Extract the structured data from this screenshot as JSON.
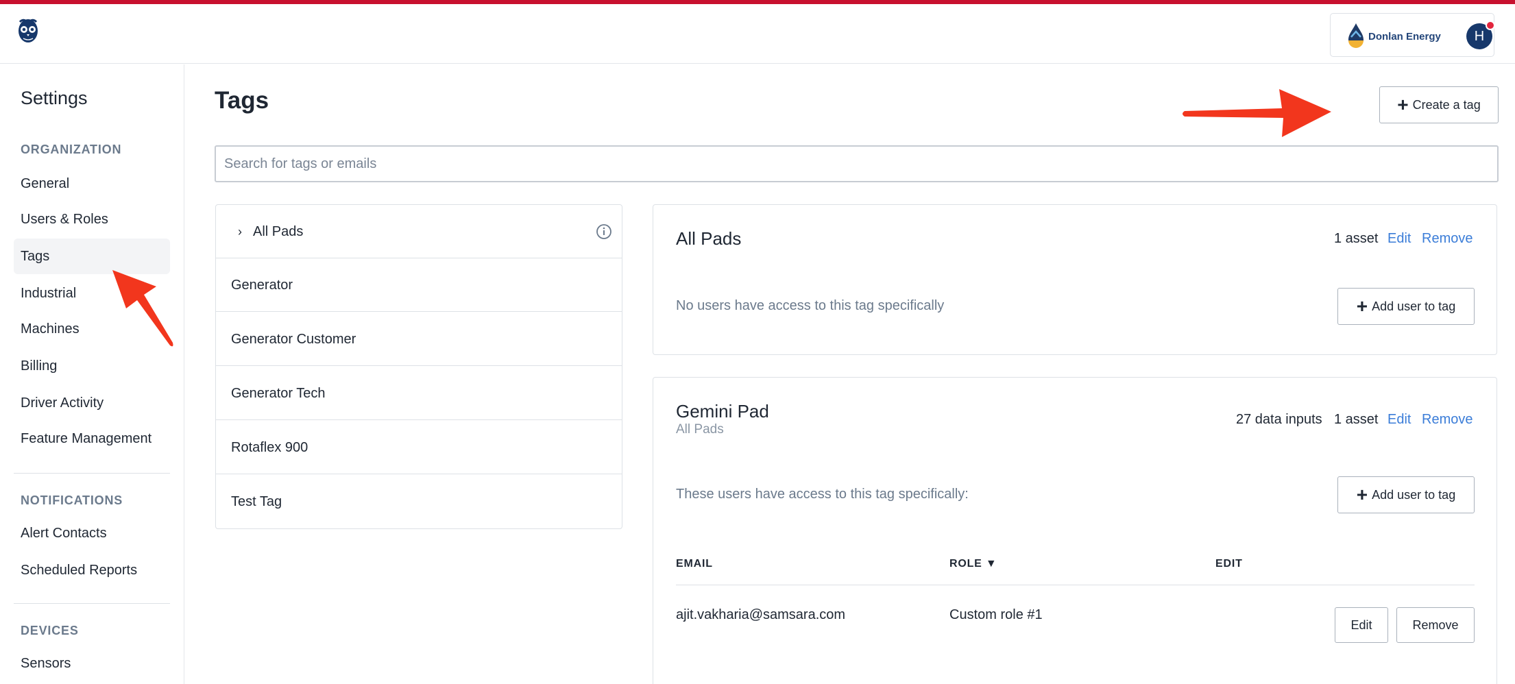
{
  "org": {
    "name": "Donlan Energy",
    "avatar_initial": "H"
  },
  "sidebar": {
    "title": "Settings",
    "sections": [
      {
        "label": "ORGANIZATION",
        "items": [
          "General",
          "Users & Roles",
          "Tags",
          "Industrial",
          "Machines",
          "Billing",
          "Driver Activity",
          "Feature Management"
        ]
      },
      {
        "label": "NOTIFICATIONS",
        "items": [
          "Alert Contacts",
          "Scheduled Reports"
        ]
      },
      {
        "label": "DEVICES",
        "items": [
          "Sensors"
        ]
      }
    ],
    "active_item": "Tags"
  },
  "main": {
    "title": "Tags",
    "create_button": "Create a tag",
    "search": {
      "placeholder": "Search for tags or emails",
      "value": ""
    }
  },
  "tag_list": [
    "All Pads",
    "Generator",
    "Generator Customer",
    "Generator Tech",
    "Rotaflex 900",
    "Test Tag"
  ],
  "cards": [
    {
      "title": "All Pads",
      "asset_count": "1 asset",
      "edit": "Edit",
      "remove": "Remove",
      "message": "No users have access to this tag specifically",
      "add_user": "Add user to tag"
    },
    {
      "title": "Gemini Pad",
      "subtitle": "All Pads",
      "data_inputs": "27 data inputs",
      "asset_count": "1 asset",
      "edit": "Edit",
      "remove": "Remove",
      "message": "These users have access to this tag specifically:",
      "add_user": "Add user to tag",
      "table": {
        "headers": [
          "EMAIL",
          "ROLE ▼",
          "EDIT"
        ],
        "rows": [
          {
            "email": "ajit.vakharia@samsara.com",
            "role": "Custom role #1",
            "edit": "Edit",
            "remove": "Remove"
          }
        ]
      }
    }
  ],
  "colors": {
    "accent_stripe": "#c8102e",
    "link": "#3b7dd8",
    "annotation_arrow": "#f2361d",
    "avatar": "#17386b"
  },
  "icons": {
    "app_logo": "owl-logo-icon",
    "org_logo": "donlan-drop-logo-icon",
    "plus": "plus-icon",
    "chevron": "chevron-right-icon",
    "info": "info-icon"
  }
}
